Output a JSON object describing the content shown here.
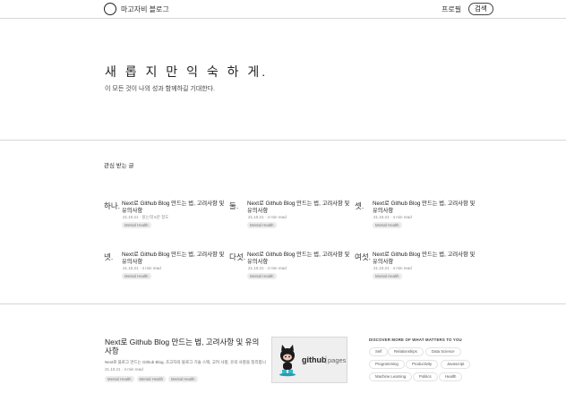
{
  "header": {
    "brand": "마고자비 블로그",
    "nav_profile": "프로필",
    "nav_search": "검색"
  },
  "hero": {
    "title": "새 롭 지 만 익 숙 하 게.",
    "subtitle": "이 모든 것이 나의 성과 함께하길 기대한다."
  },
  "featured_section": {
    "label": "관심 받는 글",
    "cards": [
      {
        "num": "하나.",
        "title": "Next로 Github Blog 만드는 법, 고려사항 및 유의사항",
        "meta": "21.10.21 · 읽는데 6분 정도",
        "tag": "Mental Health"
      },
      {
        "num": "둘.",
        "title": "Next로 Github Blog 만드는 법, 고려사항 및 유의사항",
        "meta": "21.10.21 · 4 min read",
        "tag": "Mental Health"
      },
      {
        "num": "셋.",
        "title": "Next로 Github Blog 만드는 법, 고려사항 및 유의사항",
        "meta": "21.10.21 · 4 min read",
        "tag": "Mental Health"
      },
      {
        "num": "넷.",
        "title": "Next로 Github Blog 만드는 법, 고려사항 및 유의사항",
        "meta": "21.10.21 · 4 min read",
        "tag": "Mental Health"
      },
      {
        "num": "다섯.",
        "title": "Next로 Github Blog 만드는 법, 고려사항 및 유의사항",
        "meta": "21.10.21 · 4 min read",
        "tag": "Mental Health"
      },
      {
        "num": "여섯.",
        "title": "Next로 Github Blog 만드는 법, 고려사항 및 유의사항",
        "meta": "21.10.21 · 4 min read",
        "tag": "Mental Health"
      }
    ]
  },
  "post": {
    "title": "Next로 Github Blog 만드는 법, 고려사항 및 유의사항",
    "description": "Next로 블로그 만드는 Github Blog, 초고자의 블로그 기술 스택, 고려 사항, 유의 사항을 정리합니다.",
    "meta": "21.10.21 · 4 min read",
    "tags": [
      "Mental Health",
      "Mental Health",
      "Mental Health"
    ],
    "image_label": "github",
    "image_label_suffix": "pages"
  },
  "discover": {
    "title": "DISCOVER MORE OF WHAT MATTERS TO YOU",
    "chips": [
      "Self",
      "Relationships",
      "Data Science",
      "Programming",
      "Productivity",
      "Javascript",
      "Machine Learning",
      "Politics",
      "Health"
    ]
  },
  "colors": {
    "text": "#222222",
    "muted": "#888888",
    "tag_bg": "#ececec",
    "divider": "#d6d6d6"
  }
}
